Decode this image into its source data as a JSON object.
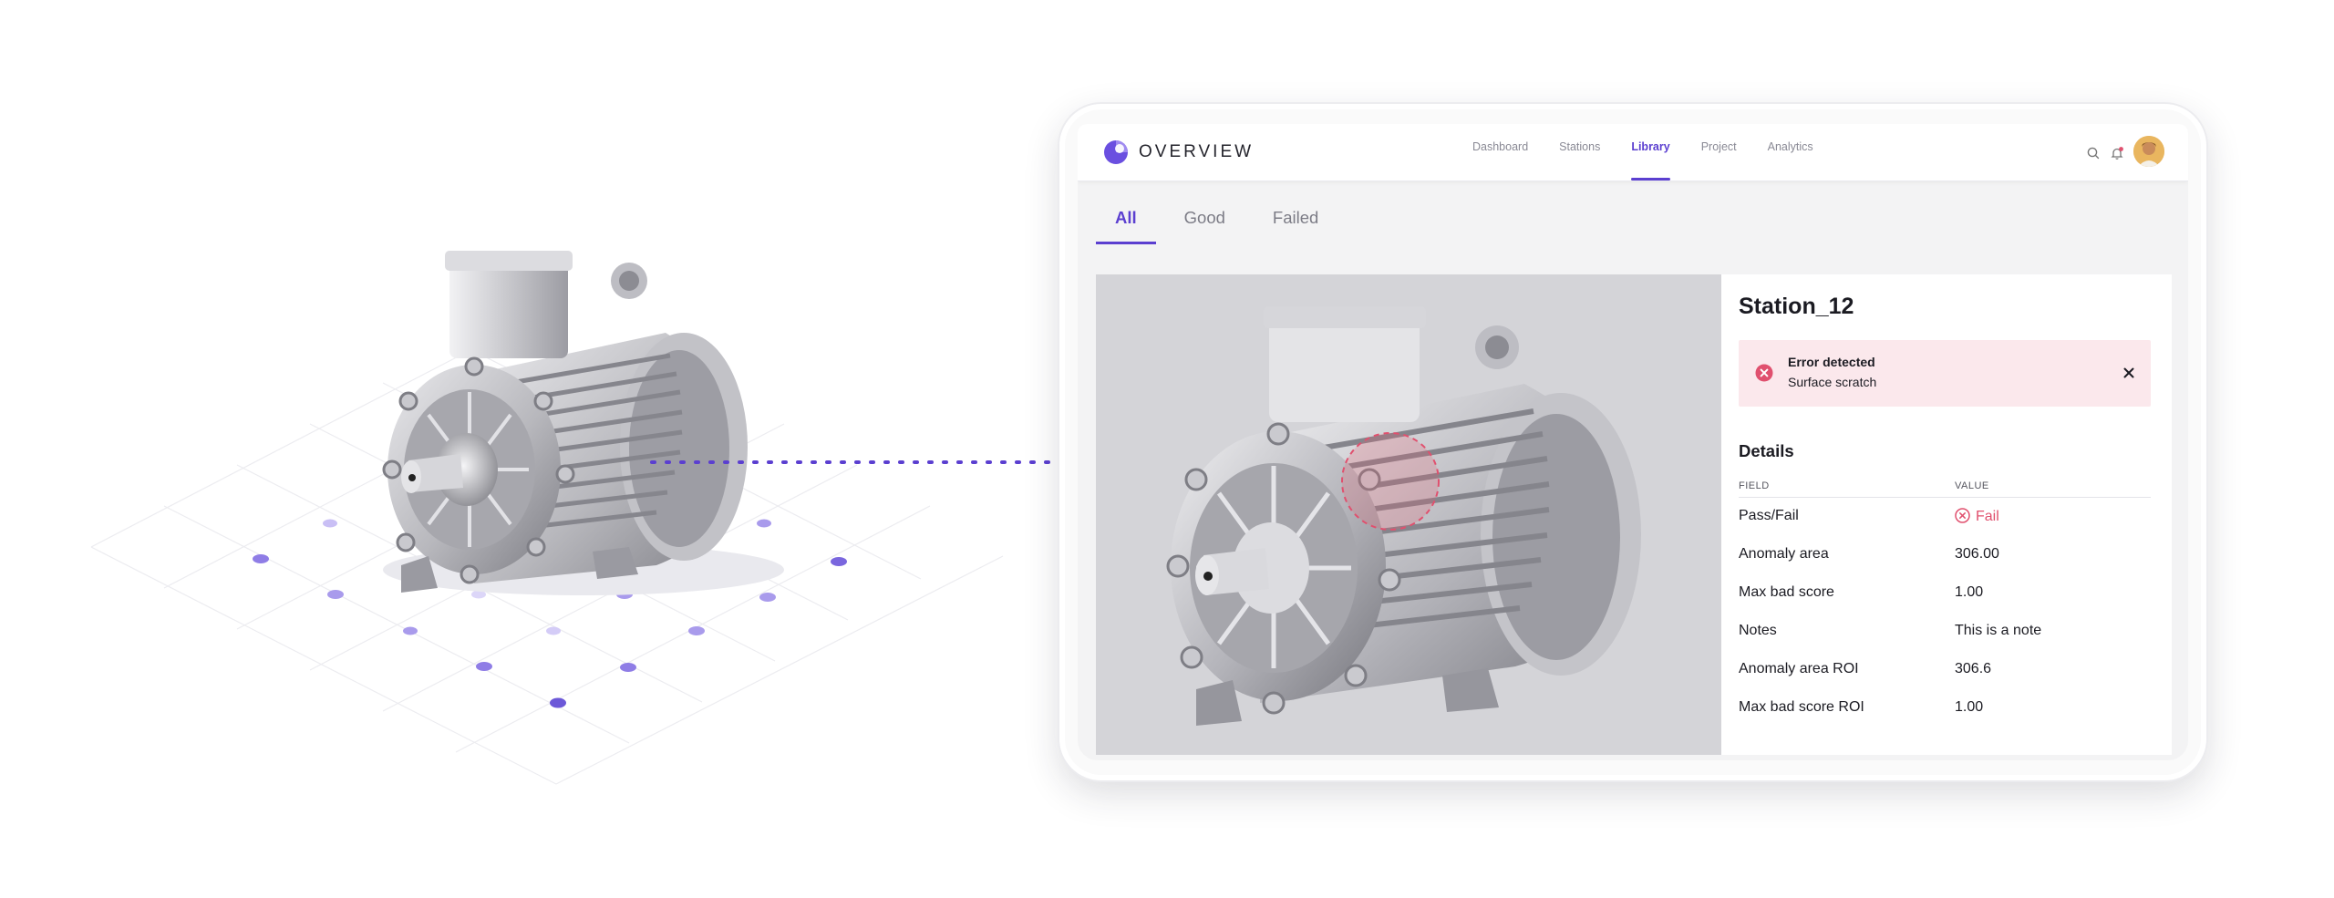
{
  "app": {
    "brand": "OVERVIEW",
    "accent_color": "#5b3fd0",
    "nav": [
      {
        "label": "Dashboard",
        "active": false
      },
      {
        "label": "Stations",
        "active": false
      },
      {
        "label": "Library",
        "active": true
      },
      {
        "label": "Project",
        "active": false
      },
      {
        "label": "Analytics",
        "active": false
      }
    ],
    "header_icons": [
      "search-icon",
      "bell-icon",
      "avatar"
    ]
  },
  "tabs": [
    {
      "label": "All",
      "active": true
    },
    {
      "label": "Good",
      "active": false
    },
    {
      "label": "Failed",
      "active": false
    }
  ],
  "detail": {
    "station": "Station_12",
    "alert": {
      "title": "Error detected",
      "message": "Surface scratch",
      "color": "#e0506e"
    },
    "section_title": "Details",
    "columns": {
      "field": "FIELD",
      "value": "VALUE"
    },
    "rows": [
      {
        "field": "Pass/Fail",
        "value": "Fail"
      },
      {
        "field": "Anomaly area",
        "value": "306.00"
      },
      {
        "field": "Max bad score",
        "value": "1.00"
      },
      {
        "field": "Notes",
        "value": "This is a note"
      },
      {
        "field": "Anomaly area ROI",
        "value": "306.6"
      },
      {
        "field": "Max bad score ROI",
        "value": "1.00"
      }
    ]
  }
}
